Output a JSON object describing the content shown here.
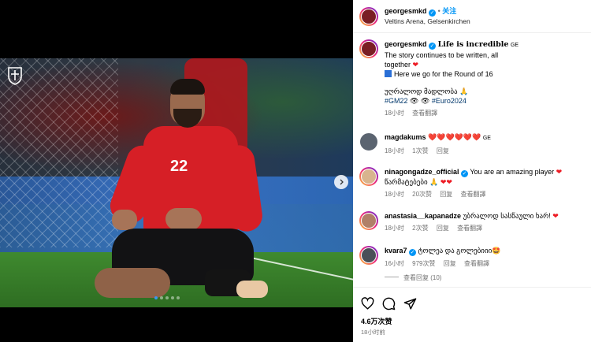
{
  "post": {
    "username": "georgesmkd",
    "follow_label": "关注",
    "location": "Veltins Arena, Gelsenkirchen",
    "likes": "4.6万次赞",
    "time": "18小时前"
  },
  "caption": {
    "username": "georgesmkd",
    "title": "Life is incredible",
    "flag": "GE",
    "line1": "The story continues to be written, all",
    "line2": "together",
    "line3": "Here we go for the Round of 16",
    "georgian": "უღრალოდ მადლობა",
    "hashtag1": "#GM22",
    "hashtag2": "#Euro2024",
    "age": "18小时",
    "translate": "查看翻譯"
  },
  "comments": [
    {
      "username": "magdakums",
      "text": "❤️❤️❤️❤️❤️❤️",
      "flag": "GE",
      "age": "18小时",
      "likes": "1次赞",
      "reply": "回复"
    },
    {
      "username": "ninagongadze_official",
      "text": "You are an amazing player",
      "text2": "წარმატებები 🙏",
      "age": "18小时",
      "likes": "20次赞",
      "reply": "回复",
      "translate": "查看翻譯"
    },
    {
      "username": "anastasia__kapanadze",
      "text": "უბრალოდ სასწაული ხარ!",
      "age": "18小时",
      "likes": "2次赞",
      "reply": "回复",
      "translate": "查看翻譯"
    },
    {
      "username": "kvara7",
      "text": "ტოლეა და გოლებიიი🤩",
      "age": "16小时",
      "likes": "979次赞",
      "reply": "回复",
      "translate": "查看翻譯"
    }
  ],
  "view_replies": "查看回复 (10)",
  "colors": {
    "accent": "#0095f6",
    "heart": "#ed1b24",
    "jersey": "#d61f26"
  },
  "icons": [
    "heart-icon",
    "comment-icon",
    "share-icon",
    "verified-icon",
    "chevron-right-icon",
    "georgia-crest-icon"
  ]
}
